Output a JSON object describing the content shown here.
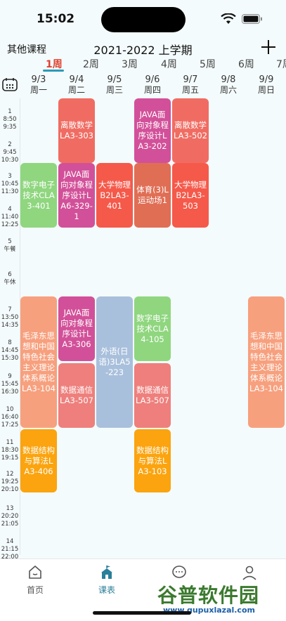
{
  "status_bar": {
    "time": "15:02"
  },
  "header": {
    "other_courses": "其他课程",
    "semester": "2021-2022 上学期",
    "add_label": "+"
  },
  "weeks": [
    "1周",
    "2周",
    "3周",
    "4周",
    "5周",
    "6周",
    "7周"
  ],
  "days": [
    {
      "date": "9/3",
      "weekday": "周一"
    },
    {
      "date": "9/4",
      "weekday": "周二"
    },
    {
      "date": "9/5",
      "weekday": "周三"
    },
    {
      "date": "9/6",
      "weekday": "周四"
    },
    {
      "date": "9/7",
      "weekday": "周五"
    },
    {
      "date": "9/8",
      "weekday": "周六"
    },
    {
      "date": "9/9",
      "weekday": "周日"
    }
  ],
  "time_slots": [
    {
      "num": "1",
      "start": "8:50",
      "end": "9:35"
    },
    {
      "num": "2",
      "start": "9:45",
      "end": "10:30"
    },
    {
      "num": "3",
      "start": "10:45",
      "end": "11:30"
    },
    {
      "num": "4",
      "start": "11:40",
      "end": "12:25"
    },
    {
      "num": "5",
      "start": "午餐",
      "end": ""
    },
    {
      "num": "6",
      "start": "午休",
      "end": ""
    },
    {
      "num": "7",
      "start": "13:50",
      "end": "14:35"
    },
    {
      "num": "8",
      "start": "14:45",
      "end": "15:30"
    },
    {
      "num": "9",
      "start": "15:45",
      "end": "16:30"
    },
    {
      "num": "10",
      "start": "16:40",
      "end": "17:25"
    },
    {
      "num": "11",
      "start": "18:30",
      "end": "19:15"
    },
    {
      "num": "12",
      "start": "19:25",
      "end": "20:10"
    },
    {
      "num": "13",
      "start": "20:20",
      "end": "21:05"
    },
    {
      "num": "14",
      "start": "21:15",
      "end": "22:00"
    }
  ],
  "courses": [
    {
      "day": 1,
      "start": 1,
      "span": 2,
      "text": "离散数学LA3-303",
      "color": "#f06c62"
    },
    {
      "day": 3,
      "start": 1,
      "span": 2,
      "text": "JAVA面向对象程序设计LA3-202",
      "color": "#d25099"
    },
    {
      "day": 4,
      "start": 1,
      "span": 2,
      "text": "离散数学LA3-502",
      "color": "#f06c62"
    },
    {
      "day": 0,
      "start": 3,
      "span": 2,
      "text": "数字电子技术CLA3-401",
      "color": "#8fd67f"
    },
    {
      "day": 1,
      "start": 3,
      "span": 2,
      "text": "JAVA面向对象程序设计LA6-329-1",
      "color": "#d25099"
    },
    {
      "day": 2,
      "start": 3,
      "span": 2,
      "text": "大学物理B2LA3-401",
      "color": "#f5594a"
    },
    {
      "day": 3,
      "start": 3,
      "span": 2,
      "text": "体育(3)L运动场1",
      "color": "#e06e55"
    },
    {
      "day": 4,
      "start": 3,
      "span": 2,
      "text": "大学物理B2LA3-503",
      "color": "#f5594a"
    },
    {
      "day": 0,
      "start": 7,
      "span": 4,
      "text": "毛泽东思想和中国特色社会主义理论体系概论LA3-104",
      "color": "#f7a07e"
    },
    {
      "day": 1,
      "start": 7,
      "span": 2,
      "text": "JAVA面向对象程序设计LA3-306",
      "color": "#d25099"
    },
    {
      "day": 2,
      "start": 7,
      "span": 4,
      "text": "外语(日语)3LA5-223",
      "color": "#a9c0dc"
    },
    {
      "day": 3,
      "start": 7,
      "span": 2,
      "text": "数字电子技术CLA4-105",
      "color": "#8fd67f"
    },
    {
      "day": 6,
      "start": 7,
      "span": 4,
      "text": "毛泽东思想和中国特色社会主义理论体系概论LA3-104",
      "color": "#f7a07e"
    },
    {
      "day": 1,
      "start": 9,
      "span": 2,
      "text": "数据通信LA3-507",
      "color": "#ee7f7c"
    },
    {
      "day": 3,
      "start": 9,
      "span": 2,
      "text": "数据通信LA3-507",
      "color": "#ee7f7c"
    },
    {
      "day": 0,
      "start": 11,
      "span": 2,
      "text": "数据结构与算法LA3-406",
      "color": "#fba40f"
    },
    {
      "day": 3,
      "start": 11,
      "span": 2,
      "text": "数据结构与算法LA3-103",
      "color": "#fba40f"
    }
  ],
  "nav": {
    "home": "首页",
    "schedule": "课表"
  },
  "watermark": {
    "main": "谷普软件园",
    "url": "www.gupuxlazal.com"
  }
}
